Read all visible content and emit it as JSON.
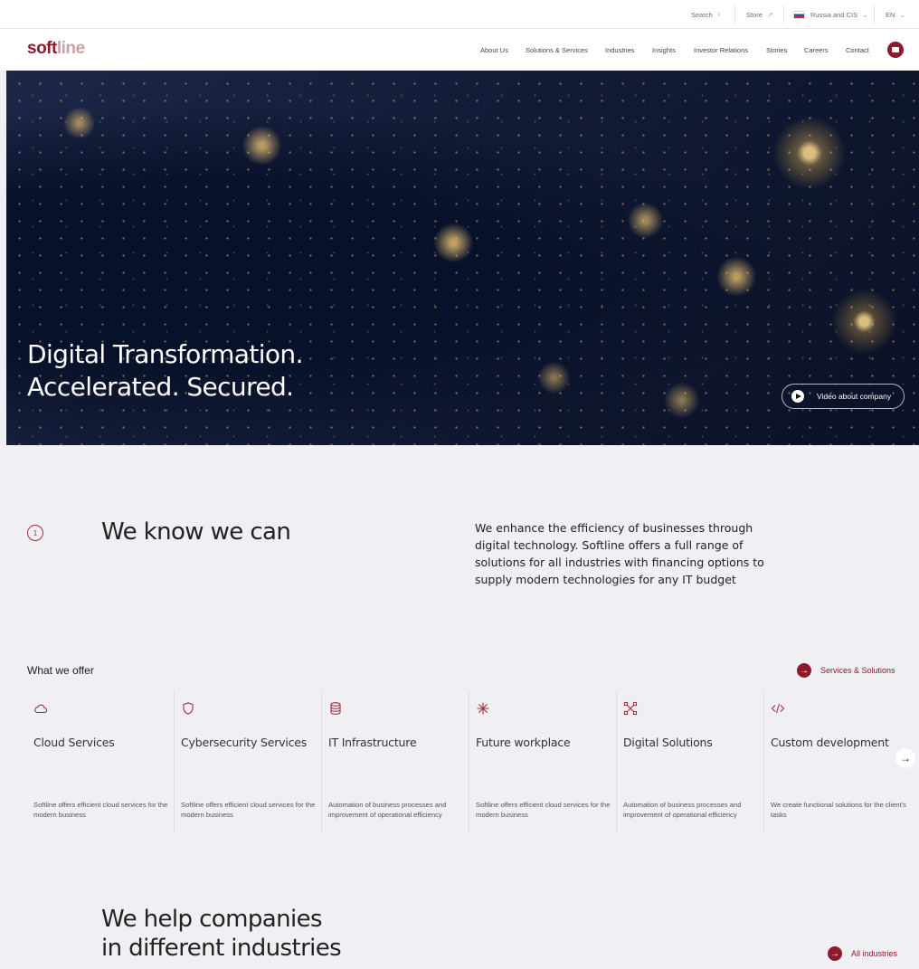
{
  "topbar": {
    "search_label": "Search",
    "store_label": "Store",
    "region_label": "Russia and CIS",
    "language_label": "EN"
  },
  "nav": {
    "logo_text": "softline",
    "items": [
      "About Us",
      "Solutions & Services",
      "Industries",
      "Insights",
      "Investor Relations",
      "Stories",
      "Careers",
      "Contact"
    ]
  },
  "hero": {
    "title_line1": "Digital Transformation.",
    "title_line2": "Accelerated. Secured.",
    "video_button_label": "Video about company"
  },
  "intro": {
    "number": "1",
    "title": "We know we can",
    "text": "We enhance the efficiency of businesses through digital technology. Softline offers a full range of solutions for all industries with financing options to supply modern technologies for any IT budget"
  },
  "offer": {
    "title": "What we offer",
    "link_label": "Services & Solutions",
    "cards": [
      {
        "icon": "cloud-icon",
        "title": "Cloud Services",
        "desc": "Softline offers efficient cloud services for the modern business"
      },
      {
        "icon": "shield-icon",
        "title": "Cybersecurity Services",
        "desc": "Softline offers efficient cloud services for the modern business"
      },
      {
        "icon": "database-icon",
        "title": "IT Infrastructure",
        "desc": "Automation of business processes and improvement of operational efficiency"
      },
      {
        "icon": "sparkle-icon",
        "title": "Future workplace",
        "desc": "Softline offers efficient cloud services for the modern business"
      },
      {
        "icon": "network-icon",
        "title": "Digital Solutions",
        "desc": "Automation of business processes and improvement of operational efficiency"
      },
      {
        "icon": "code-icon",
        "title": "Custom development",
        "desc": "We create functional solutions for the client's tasks"
      }
    ]
  },
  "industries": {
    "title_line1": "We help companies",
    "title_line2": "in different industries",
    "link_label": "All industries"
  },
  "colors": {
    "accent": "#8f1a2c",
    "page_bg": "#efeff4",
    "hero_bg": "#141d39"
  }
}
